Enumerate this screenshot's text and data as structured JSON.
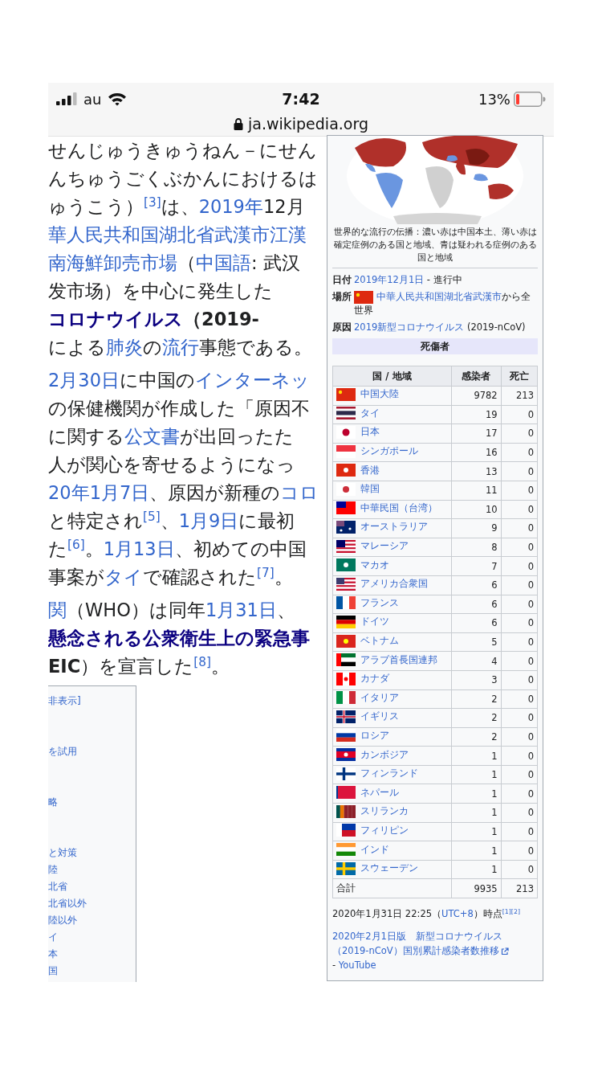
{
  "status_bar": {
    "carrier": "au",
    "time": "7:42",
    "battery": "13%",
    "url": "ja.wikipedia.org"
  },
  "article": {
    "paragraphs": [
      [
        [
          {
            "t": "せんじゅうきゅうねん－にせん",
            "kind": "text"
          }
        ],
        [
          {
            "t": "んちゅうごくぶかんにおけるは",
            "kind": "text"
          }
        ],
        [
          {
            "t": "ゅうこう）",
            "kind": "text"
          },
          {
            "t": "[3]",
            "kind": "ref"
          },
          {
            "t": "は、",
            "kind": "text"
          },
          {
            "t": "2019年",
            "kind": "link"
          },
          {
            "t": "12月",
            "kind": "text"
          }
        ],
        [
          {
            "t": "華人民共和国湖北省武漢市江漢",
            "kind": "link"
          }
        ],
        [
          {
            "t": "南海鮮卸売市場",
            "kind": "link"
          },
          {
            "t": "（",
            "kind": "text"
          },
          {
            "t": "中国語",
            "kind": "link"
          },
          {
            "t": ": 武汉",
            "kind": "text"
          }
        ],
        [
          {
            "t": "发市场）を中心に発生した",
            "kind": "text"
          }
        ],
        [
          {
            "t": "コロナウイルス",
            "kind": "boldlink"
          },
          {
            "t": "（2019-",
            "kind": "bold"
          }
        ],
        [
          {
            "t": "による",
            "kind": "text"
          },
          {
            "t": "肺炎",
            "kind": "link"
          },
          {
            "t": "の",
            "kind": "text"
          },
          {
            "t": "流行",
            "kind": "link"
          },
          {
            "t": "事態である。",
            "kind": "text"
          }
        ]
      ],
      [
        [
          {
            "t": "2月30日",
            "kind": "link"
          },
          {
            "t": "に中国の",
            "kind": "text"
          },
          {
            "t": "インターネッ",
            "kind": "link"
          }
        ],
        [
          {
            "t": "の保健機関が作成した「原因不",
            "kind": "text"
          }
        ],
        [
          {
            "t": "に関する",
            "kind": "text"
          },
          {
            "t": "公文書",
            "kind": "link"
          },
          {
            "t": "が出回ったた",
            "kind": "text"
          }
        ],
        [
          {
            "t": "人が関心を寄せるようになっ",
            "kind": "text"
          }
        ],
        [
          {
            "t": "20年1月7日",
            "kind": "link"
          },
          {
            "t": "、原因が新種の",
            "kind": "text"
          },
          {
            "t": "コロ",
            "kind": "link"
          }
        ],
        [
          {
            "t": "と特定され",
            "kind": "text"
          },
          {
            "t": "[5]",
            "kind": "ref"
          },
          {
            "t": "、",
            "kind": "text"
          },
          {
            "t": "1月9日",
            "kind": "link"
          },
          {
            "t": "に最初",
            "kind": "text"
          }
        ],
        [
          {
            "t": "た",
            "kind": "text"
          },
          {
            "t": "[6]",
            "kind": "ref"
          },
          {
            "t": "。",
            "kind": "text"
          },
          {
            "t": "1月13日",
            "kind": "link"
          },
          {
            "t": "、初めての中国",
            "kind": "text"
          }
        ],
        [
          {
            "t": "事案が",
            "kind": "text"
          },
          {
            "t": "タイ",
            "kind": "link"
          },
          {
            "t": "で確認された",
            "kind": "text"
          },
          {
            "t": "[7]",
            "kind": "ref"
          },
          {
            "t": "。",
            "kind": "text"
          }
        ]
      ],
      [
        [
          {
            "t": "関",
            "kind": "link"
          },
          {
            "t": "（WHO）は同年",
            "kind": "text"
          },
          {
            "t": "1月31日",
            "kind": "link"
          },
          {
            "t": "、",
            "kind": "text"
          }
        ],
        [
          {
            "t": "懸念される公衆衛生上の緊急事",
            "kind": "boldlink"
          }
        ],
        [
          {
            "t": "EIC",
            "kind": "bold"
          },
          {
            "t": "）を宣言した",
            "kind": "text"
          },
          {
            "t": "[8]",
            "kind": "ref"
          },
          {
            "t": "。",
            "kind": "text"
          }
        ]
      ]
    ]
  },
  "toc": {
    "groups": [
      [
        "非表示]"
      ],
      [
        "を試用"
      ],
      [
        "略"
      ],
      [
        "と対策",
        "陸",
        "北省",
        "北省以外",
        "陸以外",
        "イ",
        "本",
        "国"
      ]
    ]
  },
  "infobox": {
    "image": {
      "kind": "picture"
    },
    "caption": "世界的な流行の伝播：濃い赤は中国本土、薄い赤は確定症例のある国と地域、青は疑われる症例のある国と地域",
    "fields": [
      {
        "label": "日付",
        "value": [
          {
            "t": "2019年12月1日",
            "kind": "link"
          },
          {
            "t": " - 進行中",
            "kind": "text"
          }
        ]
      },
      {
        "label": "場所",
        "value": [
          {
            "kind": "cn"
          },
          {
            "t": "中華人民共和国湖北省武漢市",
            "kind": "link"
          },
          {
            "t": "から全世界",
            "kind": "text"
          }
        ]
      },
      {
        "label": "原因",
        "value": [
          {
            "t": "2019新型コロナウイルス",
            "kind": "link"
          },
          {
            "t": " (2019-nCoV)",
            "kind": "text"
          }
        ]
      }
    ],
    "section": "死傷者",
    "table": {
      "columns": [
        "国 / 地域",
        "感染者",
        "死亡"
      ],
      "rows": [
        {
          "kind": "cn",
          "name": "中国大陸",
          "cases": "9782",
          "deaths": "213"
        },
        {
          "kind": "th",
          "name": "タイ",
          "cases": "19",
          "deaths": "0"
        },
        {
          "kind": "jp",
          "name": "日本",
          "cases": "17",
          "deaths": "0"
        },
        {
          "kind": "sg",
          "name": "シンガポール",
          "cases": "16",
          "deaths": "0"
        },
        {
          "kind": "hk",
          "name": "香港",
          "cases": "13",
          "deaths": "0"
        },
        {
          "kind": "kr",
          "name": "韓国",
          "cases": "11",
          "deaths": "0"
        },
        {
          "kind": "tw",
          "name": "中華民国（台湾）",
          "cases": "10",
          "deaths": "0"
        },
        {
          "kind": "au",
          "name": "オーストラリア",
          "cases": "9",
          "deaths": "0"
        },
        {
          "kind": "my",
          "name": "マレーシア",
          "cases": "8",
          "deaths": "0"
        },
        {
          "kind": "mo",
          "name": "マカオ",
          "cases": "7",
          "deaths": "0"
        },
        {
          "kind": "us",
          "name": "アメリカ合衆国",
          "cases": "6",
          "deaths": "0"
        },
        {
          "kind": "fr",
          "name": "フランス",
          "cases": "6",
          "deaths": "0"
        },
        {
          "kind": "de",
          "name": "ドイツ",
          "cases": "6",
          "deaths": "0"
        },
        {
          "kind": "vn",
          "name": "ベトナム",
          "cases": "5",
          "deaths": "0"
        },
        {
          "kind": "ae",
          "name": "アラブ首長国連邦",
          "cases": "4",
          "deaths": "0"
        },
        {
          "kind": "ca",
          "name": "カナダ",
          "cases": "3",
          "deaths": "0"
        },
        {
          "kind": "it",
          "name": "イタリア",
          "cases": "2",
          "deaths": "0"
        },
        {
          "kind": "gb",
          "name": "イギリス",
          "cases": "2",
          "deaths": "0"
        },
        {
          "kind": "ru",
          "name": "ロシア",
          "cases": "2",
          "deaths": "0"
        },
        {
          "kind": "kh",
          "name": "カンボジア",
          "cases": "1",
          "deaths": "0"
        },
        {
          "kind": "fi",
          "name": "フィンランド",
          "cases": "1",
          "deaths": "0"
        },
        {
          "kind": "np",
          "name": "ネパール",
          "cases": "1",
          "deaths": "0"
        },
        {
          "kind": "lk",
          "name": "スリランカ",
          "cases": "1",
          "deaths": "0"
        },
        {
          "kind": "ph",
          "name": "フィリピン",
          "cases": "1",
          "deaths": "0"
        },
        {
          "kind": "in",
          "name": "インド",
          "cases": "1",
          "deaths": "0"
        },
        {
          "kind": "se",
          "name": "スウェーデン",
          "cases": "1",
          "deaths": "0"
        }
      ],
      "total": {
        "label": "合計",
        "cases": "9935",
        "deaths": "213"
      }
    },
    "notes": [
      [
        {
          "t": "2020年1月31日 22:25（",
          "kind": "text"
        },
        {
          "t": "UTC+8",
          "kind": "link"
        },
        {
          "t": "）時点",
          "kind": "text"
        },
        {
          "t": "[1]",
          "kind": "ref"
        },
        {
          "t": "[2]",
          "kind": "ref"
        }
      ],
      [
        {
          "t": "2020年2月1日版　新型コロナウイルス（2019-nCoV）国別累計感染者数推移",
          "kind": "extlink"
        },
        {
          "t": " - ",
          "kind": "text"
        },
        {
          "t": "YouTube",
          "kind": "link"
        }
      ]
    ]
  }
}
